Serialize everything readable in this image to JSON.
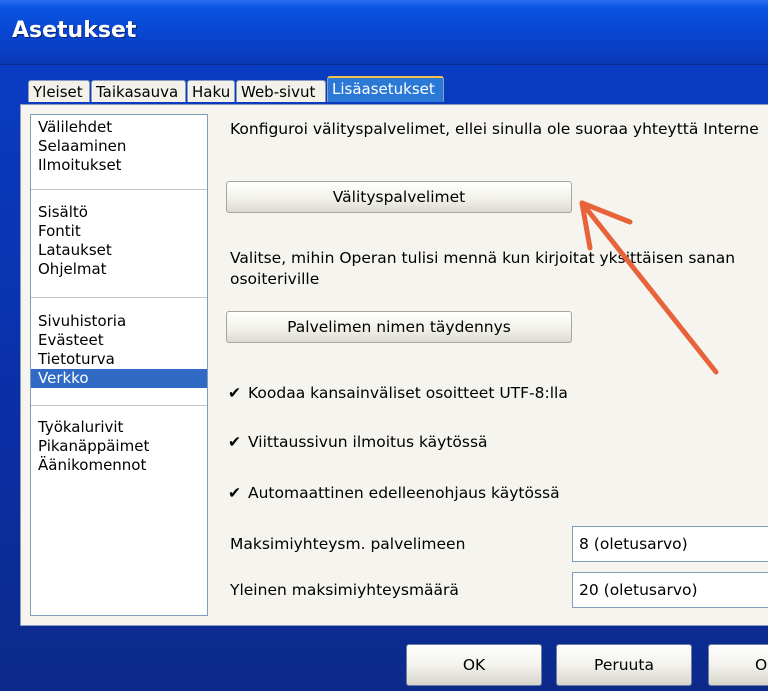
{
  "window": {
    "title": "Asetukset"
  },
  "tabs": [
    {
      "label": "Yleiset"
    },
    {
      "label": "Taikasauva"
    },
    {
      "label": "Haku"
    },
    {
      "label": "Web-sivut"
    },
    {
      "label": "Lisäasetukset"
    }
  ],
  "sidebar": {
    "groups": [
      [
        "Välilehdet",
        "Selaaminen",
        "Ilmoitukset"
      ],
      [
        "Sisältö",
        "Fontit",
        "Lataukset",
        "Ohjelmat"
      ],
      [
        "Sivuhistoria",
        "Evästeet",
        "Tietoturva",
        "Verkko"
      ],
      [
        "Työkalurivit",
        "Pikanäppäimet",
        "Äänikomennot"
      ]
    ],
    "selected": "Verkko"
  },
  "content": {
    "proxy_desc": "Konfiguroi välityspalvelimet, ellei sinulla ole suoraa yhteyttä Interne",
    "proxy_button": "Välityspalvelimet",
    "completion_desc_1": "Valitse, mihin Operan tulisi mennä kun kirjoitat yksittäisen sanan",
    "completion_desc_2": "osoiteriville",
    "completion_button": "Palvelimen nimen täydennys",
    "checks": [
      {
        "label": "Koodaa kansainväliset osoitteet UTF-8:lla",
        "checked": true
      },
      {
        "label": "Viittaussivun ilmoitus käytössä",
        "checked": true
      },
      {
        "label": "Automaattinen edelleenohjaus käytössä",
        "checked": true
      }
    ],
    "max_server_label": "Maksimiyhteysm. palvelimeen",
    "max_server_value": "8 (oletusarvo)",
    "max_total_label": "Yleinen maksimiyhteysmäärä",
    "max_total_value": "20 (oletusarvo)"
  },
  "footer": {
    "ok": "OK",
    "cancel": "Peruuta",
    "third": "O"
  },
  "colors": {
    "annotation_arrow": "#e8633a",
    "selection": "#316ac5"
  }
}
